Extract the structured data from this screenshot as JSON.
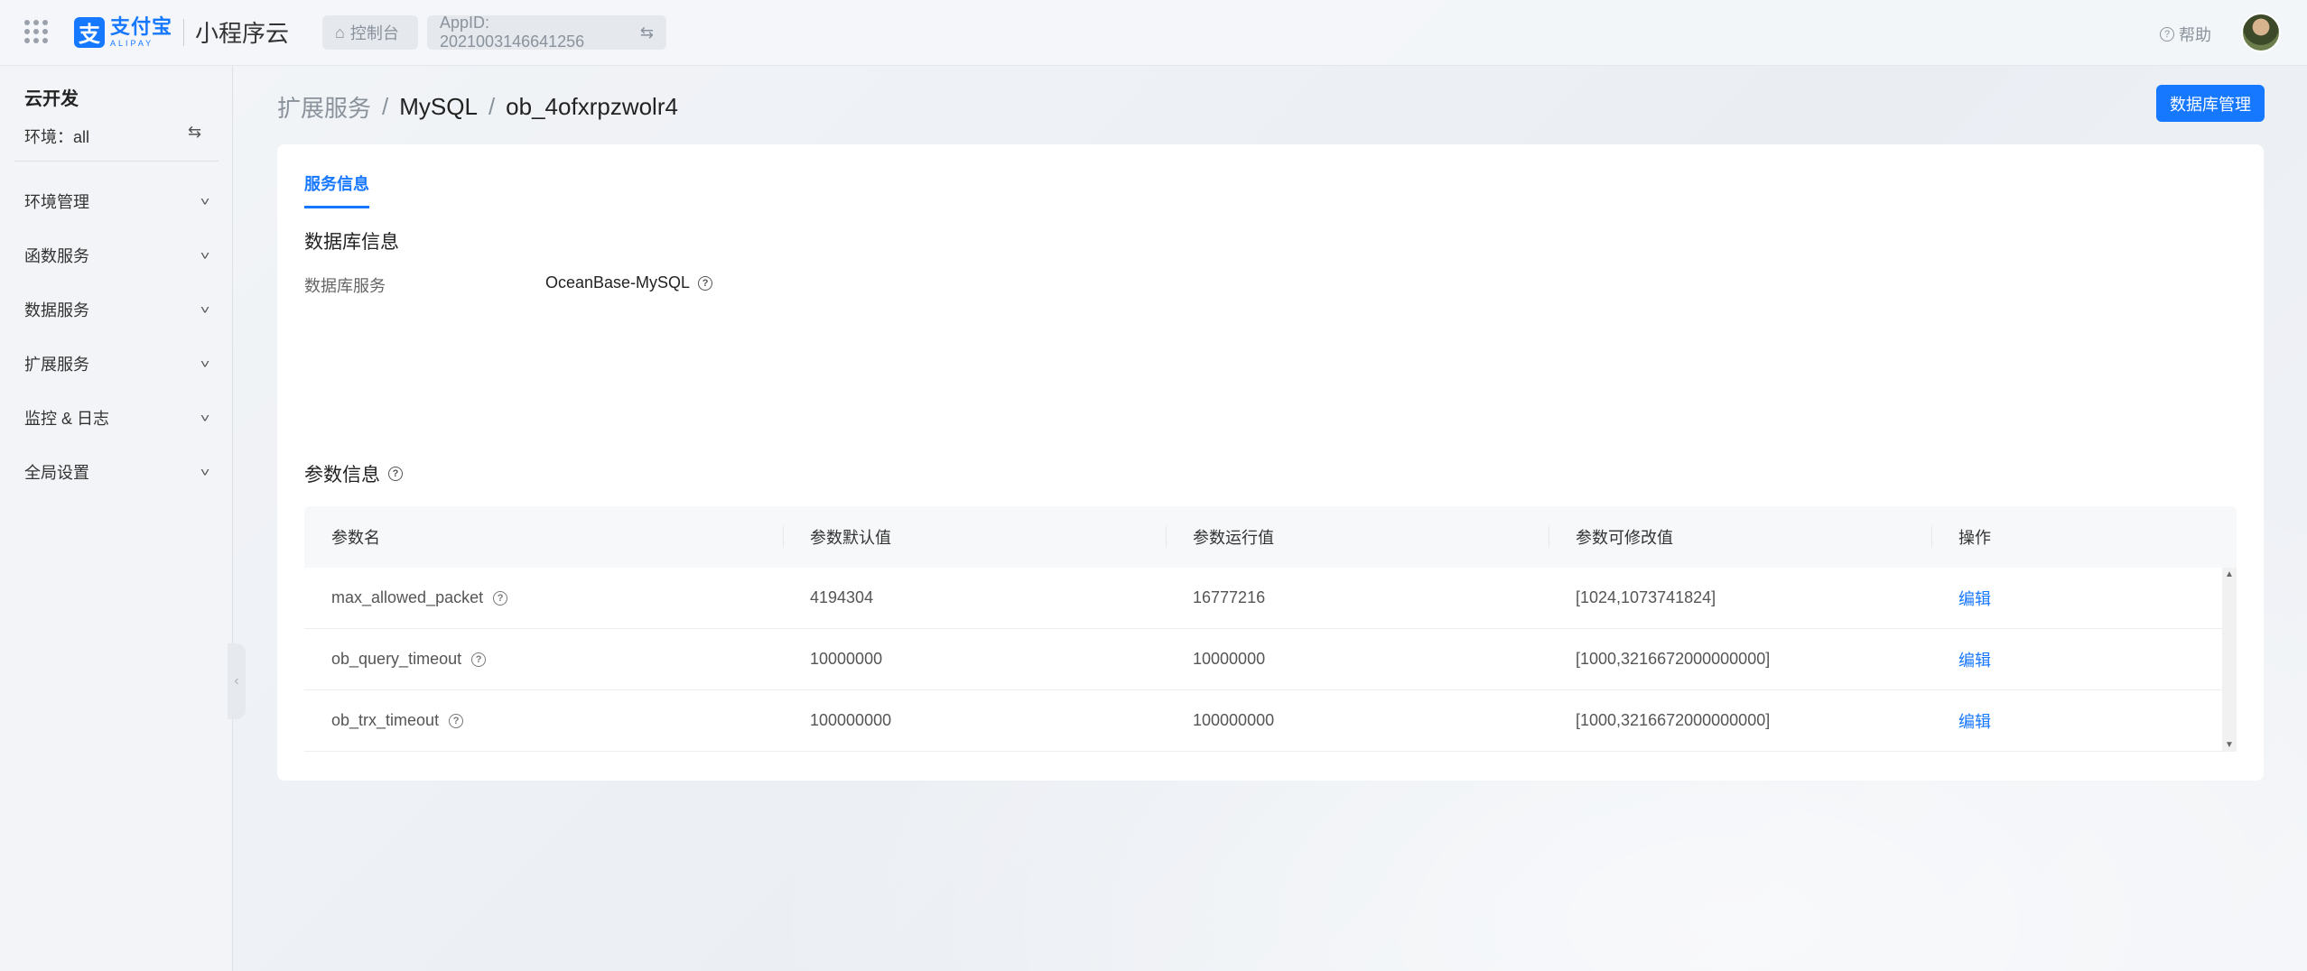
{
  "header": {
    "logo_mark": "支",
    "logo_cn": "支付宝",
    "logo_en": "ALIPAY",
    "product": "小程序云",
    "console_label": "控制台",
    "appid_label": "AppID: 2021003146641256",
    "help_label": "帮助"
  },
  "sidebar": {
    "title": "云开发",
    "env_label": "环境：all",
    "items": [
      {
        "label": "环境管理"
      },
      {
        "label": "函数服务"
      },
      {
        "label": "数据服务"
      },
      {
        "label": "扩展服务"
      },
      {
        "label": "监控 & 日志"
      },
      {
        "label": "全局设置"
      }
    ]
  },
  "breadcrumb": [
    "扩展服务",
    "MySQL",
    "ob_4ofxrpzwolr4"
  ],
  "actions": {
    "db_manage": "数据库管理"
  },
  "tabs": [
    {
      "label": "服务信息",
      "active": true
    }
  ],
  "db_info": {
    "title": "数据库信息",
    "service_label": "数据库服务",
    "service_value": "OceanBase-MySQL"
  },
  "params": {
    "title": "参数信息",
    "columns": [
      "参数名",
      "参数默认值",
      "参数运行值",
      "参数可修改值",
      "操作"
    ],
    "rows": [
      {
        "name": "max_allowed_packet",
        "default": "4194304",
        "running": "16777216",
        "range": "[1024,1073741824]",
        "action": "编辑"
      },
      {
        "name": "ob_query_timeout",
        "default": "10000000",
        "running": "10000000",
        "range": "[1000,3216672000000000]",
        "action": "编辑"
      },
      {
        "name": "ob_trx_timeout",
        "default": "100000000",
        "running": "100000000",
        "range": "[1000,3216672000000000]",
        "action": "编辑"
      }
    ]
  },
  "colors": {
    "accent": "#1677ff"
  }
}
